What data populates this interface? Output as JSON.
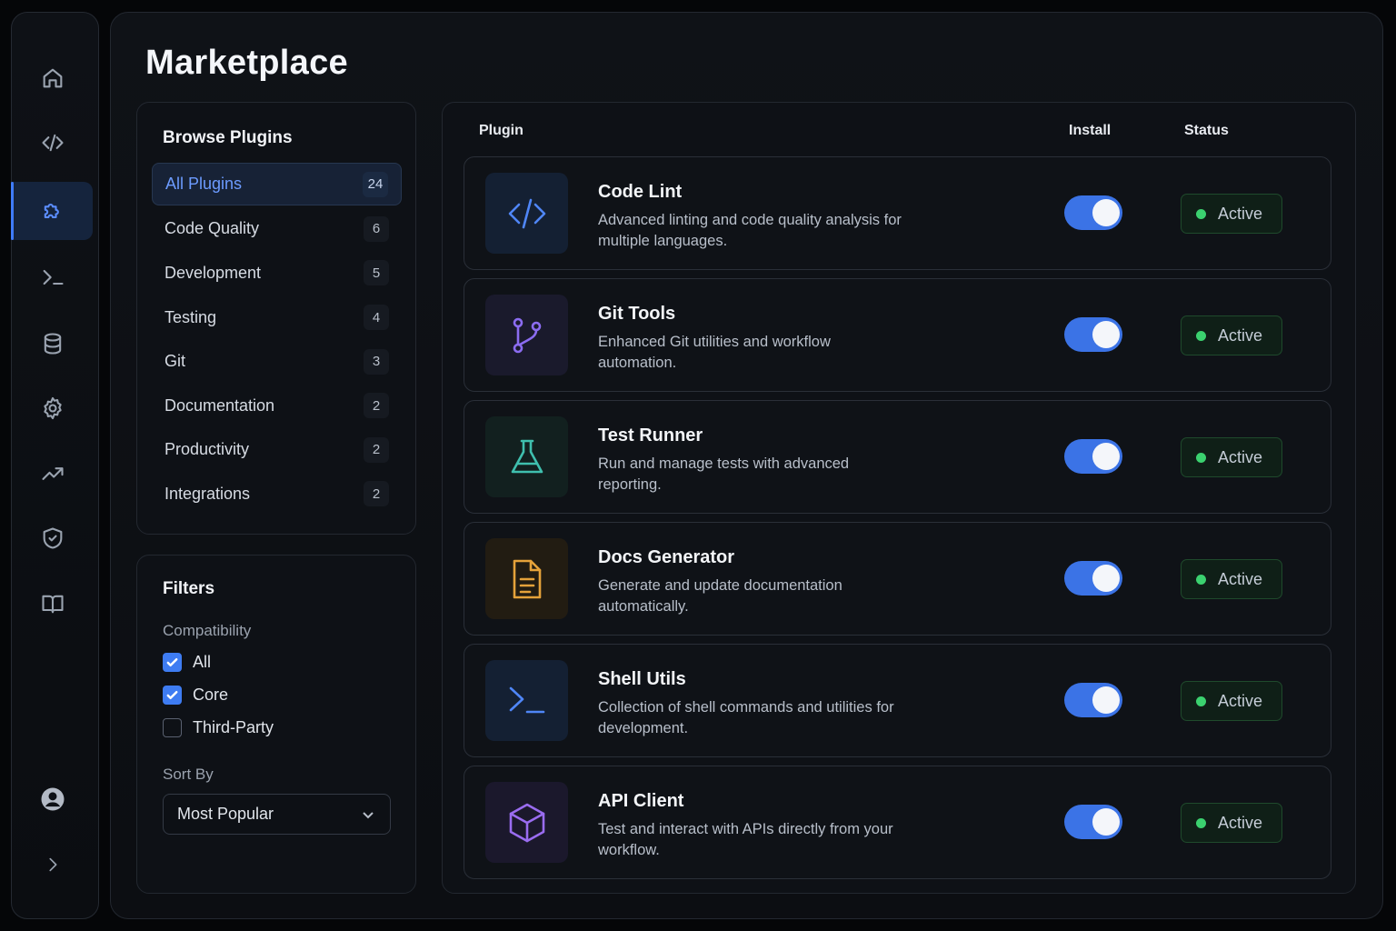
{
  "nav": {
    "items": [
      {
        "icon": "home-icon"
      },
      {
        "icon": "code-icon"
      },
      {
        "icon": "puzzle-icon",
        "active": true
      },
      {
        "icon": "terminal-icon"
      },
      {
        "icon": "database-icon"
      },
      {
        "icon": "gear-icon"
      },
      {
        "icon": "trending-up-icon"
      },
      {
        "icon": "shield-icon"
      },
      {
        "icon": "book-icon"
      }
    ],
    "bottom": [
      {
        "icon": "user-avatar-icon"
      },
      {
        "icon": "chevron-right-icon"
      }
    ]
  },
  "page": {
    "title": "Marketplace"
  },
  "browse": {
    "title": "Browse Plugins",
    "categories": [
      {
        "label": "All Plugins",
        "count": "24",
        "active": true
      },
      {
        "label": "Code Quality",
        "count": "6"
      },
      {
        "label": "Development",
        "count": "5"
      },
      {
        "label": "Testing",
        "count": "4"
      },
      {
        "label": "Git",
        "count": "3"
      },
      {
        "label": "Documentation",
        "count": "2"
      },
      {
        "label": "Productivity",
        "count": "2"
      },
      {
        "label": "Integrations",
        "count": "2"
      }
    ]
  },
  "filters": {
    "title": "Filters",
    "compat_label": "Compatibility",
    "options": [
      {
        "label": "All",
        "checked": true
      },
      {
        "label": "Core",
        "checked": true
      },
      {
        "label": "Third-Party",
        "checked": false
      }
    ],
    "sort_label": "Sort By",
    "sort_value": "Most Popular"
  },
  "table": {
    "headers": {
      "plugin": "Plugin",
      "install": "Install",
      "status": "Status"
    },
    "plugins": [
      {
        "name": "Code Lint",
        "desc": "Advanced linting and code quality analysis for multiple languages.",
        "icon": "code-icon",
        "installed": true,
        "status": "Active",
        "color": "#4f86f7",
        "bg": "#142033"
      },
      {
        "name": "Git Tools",
        "desc": "Enhanced Git utilities and workflow automation.",
        "icon": "git-branch-icon",
        "installed": true,
        "status": "Active",
        "color": "#8b6cf0",
        "bg": "#1a1a2c"
      },
      {
        "name": "Test Runner",
        "desc": "Run and manage tests with advanced reporting.",
        "icon": "flask-icon",
        "installed": true,
        "status": "Active",
        "color": "#3fbfae",
        "bg": "#12201f"
      },
      {
        "name": "Docs Generator",
        "desc": "Generate and update documentation automatically.",
        "icon": "document-icon",
        "installed": true,
        "status": "Active",
        "color": "#e5a23a",
        "bg": "#221c12"
      },
      {
        "name": "Shell Utils",
        "desc": "Collection of shell commands and utilities for development.",
        "icon": "terminal-icon",
        "installed": true,
        "status": "Active",
        "color": "#4f86f7",
        "bg": "#142033"
      },
      {
        "name": "API Client",
        "desc": "Test and interact with APIs directly from your workflow.",
        "icon": "cube-icon",
        "installed": true,
        "status": "Active",
        "color": "#9a6cf0",
        "bg": "#1b182c"
      }
    ]
  }
}
